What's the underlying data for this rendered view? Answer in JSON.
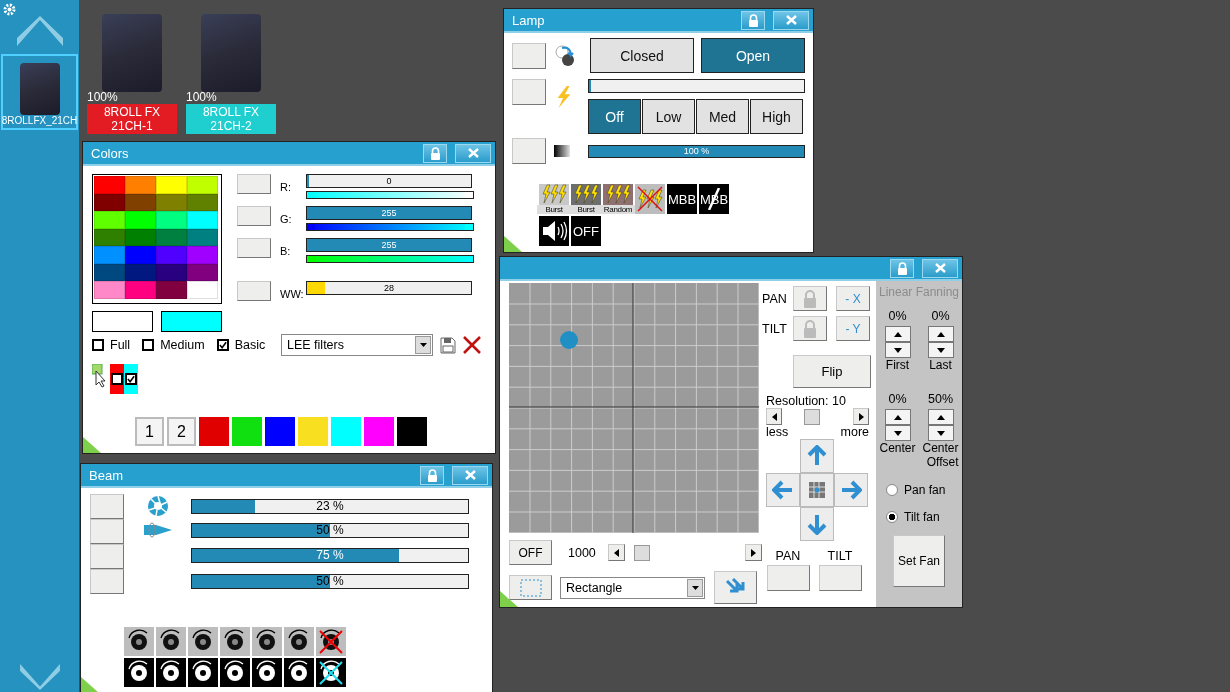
{
  "sidebar": {
    "fixtures": [
      {
        "label": "8ROLLFX_21CH",
        "selected": true
      }
    ]
  },
  "fixtures": [
    {
      "percent": "100%",
      "name": "8ROLL FX\n21CH-1",
      "color": "#e31b23"
    },
    {
      "percent": "100%",
      "name": "8ROLL FX\n21CH-2",
      "color": "#1fcfcf"
    }
  ],
  "lamp": {
    "title": "Lamp",
    "shutter": [
      {
        "label": "Closed",
        "selected": false
      },
      {
        "label": "Open",
        "selected": true
      }
    ],
    "strobe": {
      "level": 0
    },
    "power": [
      {
        "label": "Off",
        "selected": true
      },
      {
        "label": "Low",
        "selected": false
      },
      {
        "label": "Med",
        "selected": false
      },
      {
        "label": "High",
        "selected": false
      }
    ],
    "dimmer": {
      "level": 1,
      "reading": "100 %"
    },
    "effects": [
      {
        "kind": "burst",
        "label": "Burst",
        "color": "#c8c8c8"
      },
      {
        "kind": "burst",
        "label": "Burst",
        "color": "#6e6e6e"
      },
      {
        "kind": "burst",
        "label": "Random",
        "color": "#8e7070"
      },
      {
        "kind": "strobe-off"
      },
      {
        "kind": "text",
        "label": "MBB"
      },
      {
        "kind": "text-off",
        "label": "MBB"
      },
      {
        "kind": "sound"
      },
      {
        "kind": "text",
        "label": "OFF"
      }
    ]
  },
  "colors": {
    "title": "Colors",
    "palette": [
      {
        "color": "#ff0000"
      },
      {
        "color": "#ff8000"
      },
      {
        "color": "#ffff00"
      },
      {
        "color": "#bfff00"
      },
      {
        "color": "#800000"
      },
      {
        "color": "#804000"
      },
      {
        "color": "#808000"
      },
      {
        "color": "#608000"
      },
      {
        "color": "#60ff00"
      },
      {
        "color": "#00ff00"
      },
      {
        "color": "#00ff80"
      },
      {
        "color": "#00ffff"
      },
      {
        "color": "#308000"
      },
      {
        "color": "#008000"
      },
      {
        "color": "#008040"
      },
      {
        "color": "#008080"
      },
      {
        "color": "#0090ff"
      },
      {
        "color": "#0000ff"
      },
      {
        "color": "#5000ff"
      },
      {
        "color": "#a000ff"
      },
      {
        "color": "#004880"
      },
      {
        "color": "#001880"
      },
      {
        "color": "#280080"
      },
      {
        "color": "#800080"
      },
      {
        "color": "#ff88c8"
      },
      {
        "color": "#ff0080"
      },
      {
        "color": "#800040"
      },
      {
        "color": "#ffffff"
      }
    ],
    "channels": [
      {
        "kind": "rgb",
        "label": "R:",
        "reading": "0",
        "level": 0,
        "gradient": [
          {
            "color": "#00ffff"
          },
          {
            "color": "#ffffff"
          }
        ]
      },
      {
        "kind": "rgb",
        "label": "G:",
        "reading": "255",
        "level": 1,
        "gradient": [
          {
            "color": "#0000ff"
          },
          {
            "color": "#00ffff"
          }
        ]
      },
      {
        "kind": "rgb",
        "label": "B:",
        "reading": "255",
        "level": 1,
        "gradient": [
          {
            "color": "#00ff00"
          },
          {
            "color": "#00ffff"
          }
        ]
      },
      {
        "kind": "white",
        "label": "WW:",
        "reading": "28",
        "level": 0.11
      }
    ],
    "previews": [
      {
        "color": "#ffffff"
      },
      {
        "color": "#00ffff"
      }
    ],
    "filters": [
      {
        "label": "Full",
        "checked": false
      },
      {
        "label": "Medium",
        "checked": false
      },
      {
        "label": "Basic",
        "checked": true
      }
    ],
    "filter_set": {
      "value": "LEE filters"
    },
    "selection": [
      {
        "color": "#ff0000",
        "checked": false
      },
      {
        "color": "#00ffff",
        "checked": true
      }
    ],
    "presets": [
      {
        "kind": "number",
        "label": "1"
      },
      {
        "kind": "number",
        "label": "2"
      },
      {
        "kind": "swatch",
        "color": "#e00000"
      },
      {
        "kind": "swatch",
        "color": "#10e010"
      },
      {
        "kind": "swatch",
        "color": "#0000ff"
      },
      {
        "kind": "swatch",
        "color": "#f8e020"
      },
      {
        "kind": "swatch",
        "color": "#00ffff"
      },
      {
        "kind": "swatch",
        "color": "#ff00ff"
      },
      {
        "kind": "swatch",
        "color": "#000000"
      }
    ]
  },
  "beam": {
    "title": "Beam",
    "bars": [
      {
        "kind": "iris",
        "reading": "23 %",
        "level": 0.23
      },
      {
        "kind": "focus",
        "reading": "50 %",
        "level": 0.5
      },
      {
        "kind": "plain",
        "reading": "75 %",
        "level": 0.75
      },
      {
        "kind": "plain",
        "reading": "50 %",
        "level": 0.5
      }
    ]
  },
  "position": {
    "axes": [
      {
        "label": "PAN",
        "invert": "- X"
      },
      {
        "label": "TILT",
        "invert": "- Y"
      }
    ],
    "flip": "Flip",
    "resolution": {
      "label": "Resolution: 10",
      "level": 0.4,
      "less": "less",
      "more": "more"
    },
    "off": "OFF",
    "speed": {
      "reading": "1000",
      "level": 0.04
    },
    "shape": {
      "value": "Rectangle"
    },
    "outputs": [
      "PAN",
      "TILT"
    ],
    "fanning": {
      "title": "Linear Fanning",
      "values": [
        "0%",
        "0%",
        "0%",
        "50%"
      ],
      "captions": [
        "First",
        "Last",
        "Center",
        "Center\nOffset"
      ],
      "modes": [
        {
          "label": "Pan fan",
          "selected": false
        },
        {
          "label": "Tilt fan",
          "selected": true
        }
      ],
      "set": "Set Fan"
    }
  }
}
